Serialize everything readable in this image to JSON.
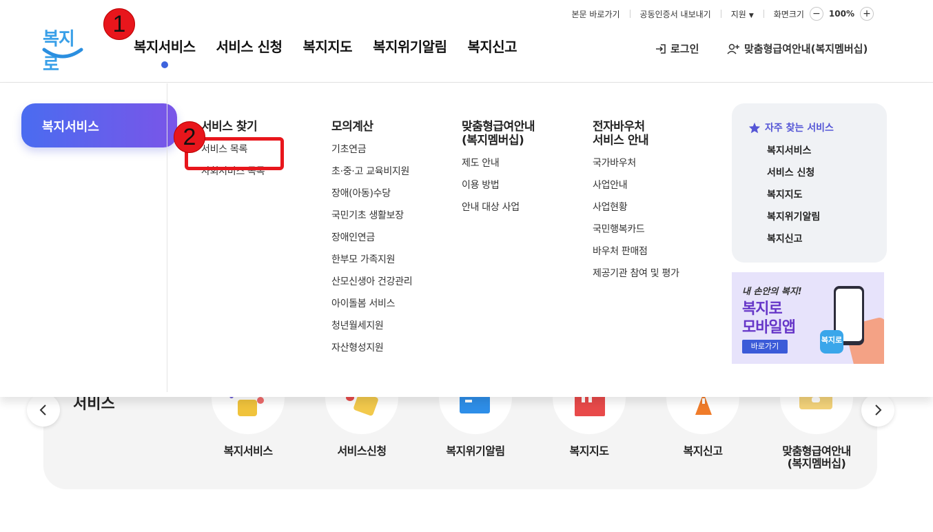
{
  "header": {
    "logo_text": "복지로",
    "util_links": [
      "본문 바로가기",
      "공동인증서 내보내기",
      "지원",
      "화면크기"
    ],
    "zoom_minus": "−",
    "zoom_value": "100%",
    "zoom_plus": "+",
    "nav": [
      "복지서비스",
      "서비스 신청",
      "복지지도",
      "복지위기알림",
      "복지신고"
    ],
    "login": "로그인",
    "membership": "맞춤형급여안내(복지멤버십)"
  },
  "annotations": {
    "badge1": "1",
    "badge2": "2"
  },
  "dropdown": {
    "side_title": "복지서비스",
    "columns": [
      {
        "title": "서비스 찾기",
        "items": [
          "서비스 목록",
          "사회서비스 목록"
        ]
      },
      {
        "title": "모의계산",
        "items": [
          "기초연금",
          "초·중·고 교육비지원",
          "장애(아동)수당",
          "국민기초 생활보장",
          "장애인연금",
          "한부모 가족지원",
          "산모신생아 건강관리",
          "아이돌봄 서비스",
          "청년월세지원",
          "자산형성지원"
        ]
      },
      {
        "title_line1": "맞춤형급여안내",
        "title_line2": "(복지멤버십)",
        "items": [
          "제도 안내",
          "이용 방법",
          "안내 대상 사업"
        ]
      },
      {
        "title_line1": "전자바우처",
        "title_line2": "서비스 안내",
        "items": [
          "국가바우처",
          "사업안내",
          "사업현황",
          "국민행복카드",
          "바우처 판매점",
          "제공기관 참여 및 평가"
        ]
      }
    ],
    "favorites": {
      "title": "자주 찾는 서비스",
      "items": [
        "복지서비스",
        "서비스 신청",
        "복지지도",
        "복지위기알림",
        "복지신고"
      ]
    },
    "banner": {
      "small": "내 손안의 복지!",
      "big_line1": "복지로",
      "big_line2": "모바일앱",
      "button": "바로가기",
      "mini_logo": "복지로"
    }
  },
  "background": {
    "heading": "서비스",
    "services": [
      "복지서비스",
      "서비스신청",
      "복지위기알림",
      "복지지도",
      "복지신고"
    ],
    "service6_line1": "맞춤형급여안내",
    "service6_line2": "(복지멤버십)"
  },
  "colors": {
    "accent": "#3d63dd",
    "annotation": "#e8161c",
    "favorite": "#5556d6"
  }
}
